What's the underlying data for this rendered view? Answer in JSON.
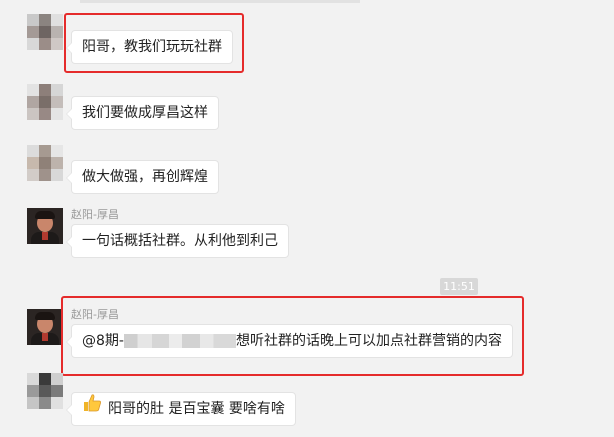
{
  "messages": [
    {
      "text": "阳哥，教我们玩玩社群"
    },
    {
      "text": "我们要做成厚昌这样"
    },
    {
      "text": "做大做强，再创辉煌"
    },
    {
      "sender": "赵阳-厚昌",
      "text": "一句话概括社群。从利他到利己"
    },
    {
      "sender": "赵阳-厚昌",
      "mention": "@8期-",
      "text": "想听社群的话晚上可以加点社群营销的内容"
    },
    {
      "emoji": "thumbs-up-icon",
      "text": "阳哥的肚 是百宝囊 要啥有啥"
    }
  ],
  "timestamp": "11:51",
  "colors": {
    "highlight": "#e52b2b",
    "background": "#f2f2f2",
    "bubble": "#ffffff"
  }
}
